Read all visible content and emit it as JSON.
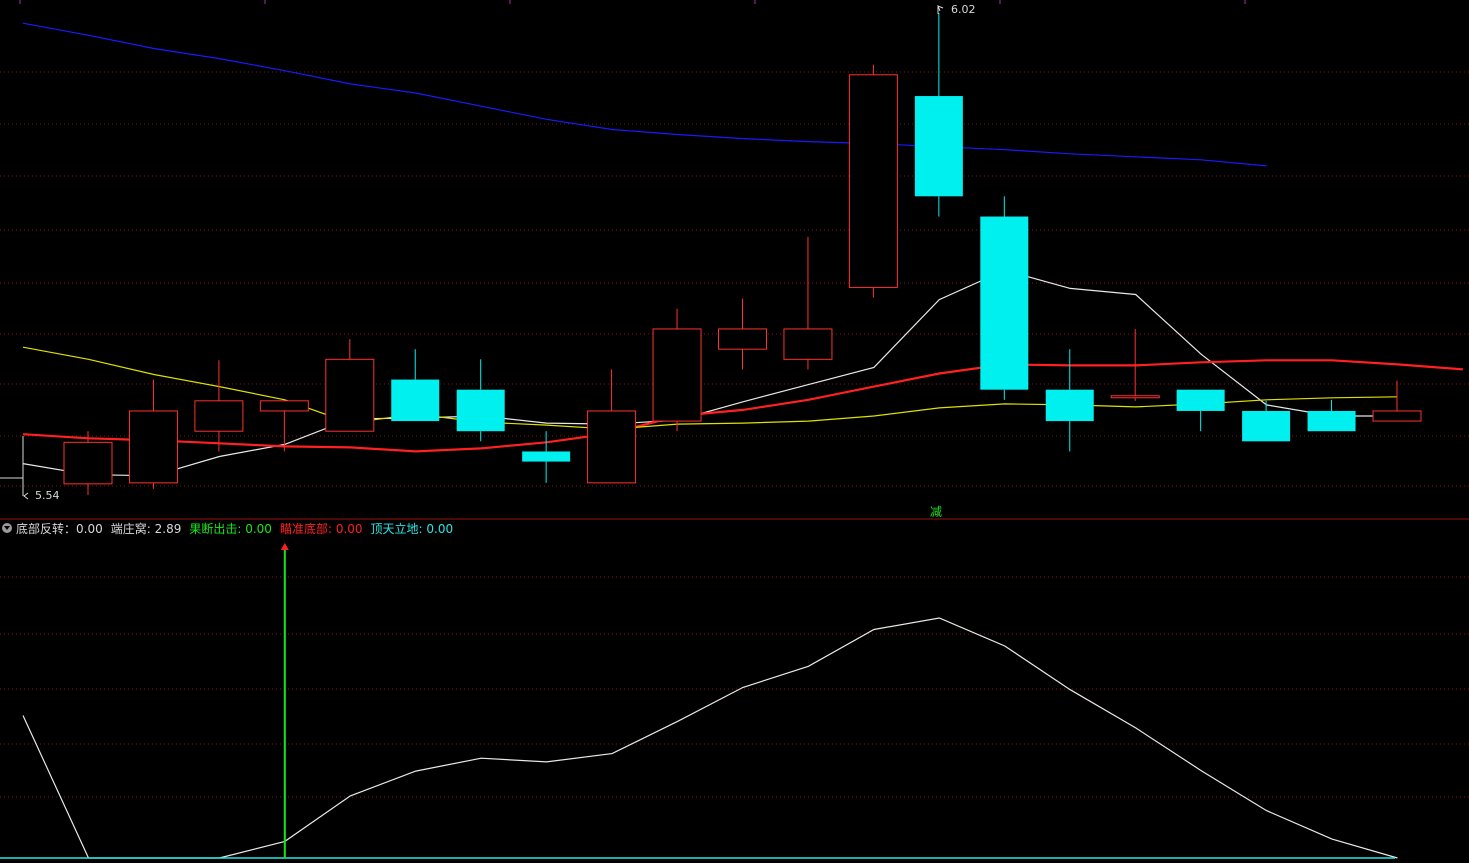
{
  "chart_data": [
    {
      "type": "candlestick",
      "high_marker": "6.02",
      "low_marker": "5.54",
      "signal_label": "减",
      "series": [
        {
          "name": "MA-blue",
          "color": "#1a1aff",
          "values": [
            6.007,
            5.995,
            5.982,
            5.972,
            5.96,
            5.947,
            5.938,
            5.925,
            5.912,
            5.902,
            5.897,
            5.893,
            5.89,
            5.888,
            5.885,
            5.882,
            5.878,
            5.875,
            5.872,
            5.866
          ]
        },
        {
          "name": "MA-white",
          "color": "#e8e8e8",
          "values": [
            5.572,
            5.561,
            5.56,
            5.579,
            5.591,
            5.616,
            5.617,
            5.619,
            5.612,
            5.611,
            5.615,
            5.633,
            5.65,
            5.667,
            5.734,
            5.763,
            5.745,
            5.739,
            5.68,
            5.63,
            5.619,
            5.619
          ]
        },
        {
          "name": "MA-red",
          "color": "#ff2020",
          "values": [
            5.601,
            5.597,
            5.595,
            5.592,
            5.589,
            5.588,
            5.584,
            5.587,
            5.593,
            5.602,
            5.619,
            5.625,
            5.635,
            5.648,
            5.661,
            5.67,
            5.669,
            5.669,
            5.672,
            5.674,
            5.674,
            5.67,
            5.665
          ]
        },
        {
          "name": "MA-yellow",
          "color": "#e0e000",
          "values": [
            5.687,
            5.675,
            5.66,
            5.648,
            5.635,
            5.612,
            5.621,
            5.613,
            5.61,
            5.606,
            5.611,
            5.612,
            5.614,
            5.619,
            5.627,
            5.631,
            5.63,
            5.628,
            5.631,
            5.635,
            5.637,
            5.638
          ]
        }
      ],
      "candles": [
        {
          "x": 1,
          "open": 5.552,
          "close": 5.593,
          "high": 5.604,
          "low": 5.541
        },
        {
          "x": 2,
          "open": 5.553,
          "close": 5.624,
          "high": 5.655,
          "low": 5.547
        },
        {
          "x": 3,
          "open": 5.604,
          "close": 5.634,
          "high": 5.674,
          "low": 5.584
        },
        {
          "x": 4,
          "open": 5.624,
          "close": 5.634,
          "high": 5.634,
          "low": 5.584
        },
        {
          "x": 5,
          "open": 5.604,
          "close": 5.675,
          "high": 5.695,
          "low": 5.604
        },
        {
          "x": 6,
          "open": 5.655,
          "close": 5.614,
          "high": 5.685,
          "low": 5.614
        },
        {
          "x": 7,
          "open": 5.645,
          "close": 5.604,
          "high": 5.675,
          "low": 5.594
        },
        {
          "x": 8,
          "open": 5.584,
          "close": 5.574,
          "high": 5.604,
          "low": 5.553
        },
        {
          "x": 9,
          "open": 5.553,
          "close": 5.624,
          "high": 5.665,
          "low": 5.553
        },
        {
          "x": 10,
          "open": 5.614,
          "close": 5.705,
          "high": 5.725,
          "low": 5.604
        },
        {
          "x": 11,
          "open": 5.685,
          "close": 5.705,
          "high": 5.735,
          "low": 5.665
        },
        {
          "x": 12,
          "open": 5.675,
          "close": 5.705,
          "high": 5.796,
          "low": 5.665
        },
        {
          "x": 13,
          "open": 5.746,
          "close": 5.956,
          "high": 5.966,
          "low": 5.736
        },
        {
          "x": 14,
          "open": 5.935,
          "close": 5.836,
          "high": 6.017,
          "low": 5.816
        },
        {
          "x": 15,
          "open": 5.816,
          "close": 5.645,
          "high": 5.836,
          "low": 5.635
        },
        {
          "x": 16,
          "open": 5.645,
          "close": 5.614,
          "high": 5.685,
          "low": 5.584
        },
        {
          "x": 17,
          "open": 5.639,
          "close": 5.639,
          "high": 5.705,
          "low": 5.634
        },
        {
          "x": 18,
          "open": 5.645,
          "close": 5.624,
          "high": 5.645,
          "low": 5.604
        },
        {
          "x": 19,
          "open": 5.624,
          "close": 5.594,
          "high": 5.634,
          "low": 5.594
        },
        {
          "x": 20,
          "open": 5.624,
          "close": 5.604,
          "high": 5.635,
          "low": 5.604
        },
        {
          "x": 21,
          "open": 5.614,
          "close": 5.624,
          "high": 5.654,
          "low": 5.614
        }
      ]
    },
    {
      "type": "line",
      "legend": [
        {
          "label": "底部反转",
          "value": "0.00",
          "color": "#d8d8d8",
          "sep": "："
        },
        {
          "label": "端庄窝",
          "value": "2.89",
          "color": "#d8d8d8",
          "sep": ": "
        },
        {
          "label": "果断出击",
          "value": "0.00",
          "color": "#19e619",
          "sep": ": "
        },
        {
          "label": "瞄准底部",
          "value": "0.00",
          "color": "#ff2020",
          "sep": ": "
        },
        {
          "label": "顶天立地",
          "value": "0.00",
          "color": "#28e6e6",
          "sep": ": "
        }
      ],
      "series": [
        {
          "name": "端庄窝",
          "color": "#e8e8e8",
          "values": [
            3.1,
            0.0,
            0.0,
            0.0,
            0.36,
            1.35,
            1.89,
            2.17,
            2.09,
            2.27,
            2.97,
            3.71,
            4.17,
            4.97,
            5.22,
            4.61,
            3.66,
            2.83,
            1.9,
            1.03,
            0.41,
            0.0
          ]
        },
        {
          "name": "果断出击",
          "color": "#19e619",
          "signal_x": 4
        }
      ],
      "ylim": [
        0,
        6.5
      ]
    }
  ]
}
